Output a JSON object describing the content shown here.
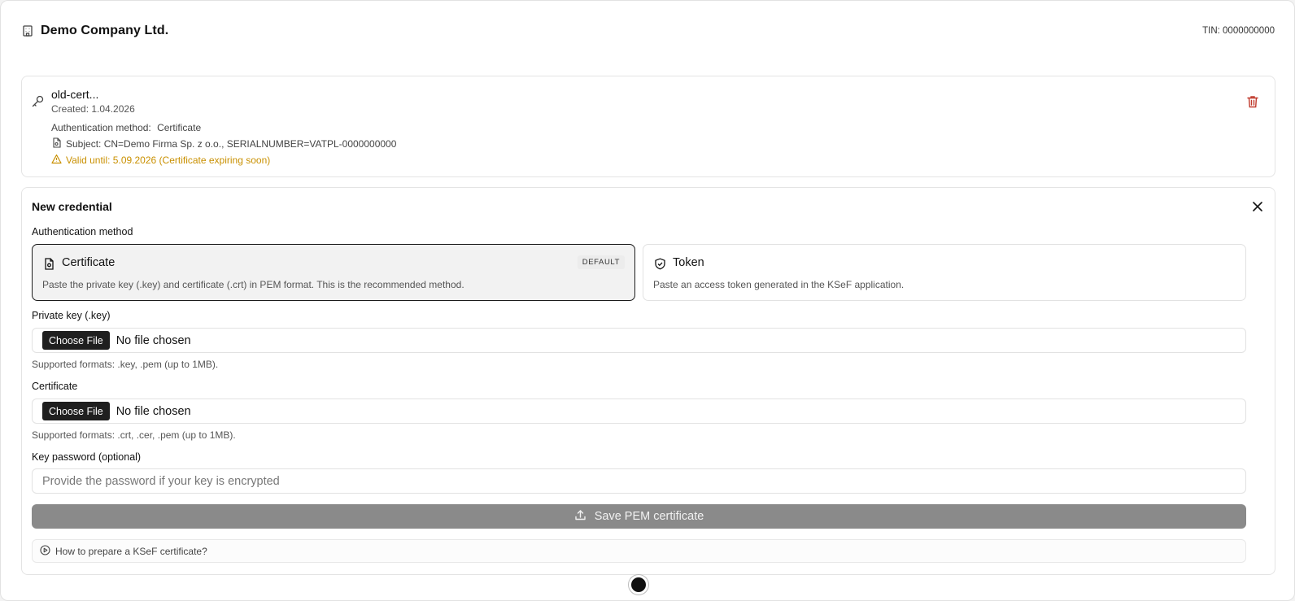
{
  "header": {
    "company_name": "Demo Company Ltd.",
    "tin": "TIN: 0000000000",
    "icon": "building-icon"
  },
  "existing_credential": {
    "name": "old-cert...",
    "created": "Created: 1.04.2026",
    "method_label": "Authentication method:",
    "method_value": "Certificate",
    "subject": "Subject: CN=Demo Firma Sp. z o.o., SERIALNUMBER=VATPL-0000000000",
    "valid_until": "Valid until: 5.09.2026 (Certificate expiring soon)",
    "warning_color": "#c99000",
    "delete_color": "#c0392b"
  },
  "new_credential": {
    "title": "New credential",
    "auth_method_label": "Authentication method",
    "methods": [
      {
        "title": "Certificate",
        "badge": "DEFAULT",
        "description": "Paste the private key (.key) and certificate (.crt) in PEM format. This is the recommended method.",
        "selected": true
      },
      {
        "title": "Token",
        "badge": "",
        "description": "Paste an access token generated in the KSeF application.",
        "selected": false
      }
    ],
    "private_key": {
      "label": "Private key (.key)",
      "button": "Choose File",
      "status": "No file chosen",
      "hint": "Supported formats: .key, .pem (up to 1MB)."
    },
    "certificate": {
      "label": "Certificate",
      "button": "Choose File",
      "status": "No file chosen",
      "hint": "Supported formats: .crt, .cer, .pem (up to 1MB)."
    },
    "password": {
      "label": "Key password (optional)",
      "placeholder": "Provide the password if your key is encrypted",
      "value": ""
    },
    "save_button": "Save PEM certificate",
    "help_link": "How to prepare a KSeF certificate?"
  }
}
